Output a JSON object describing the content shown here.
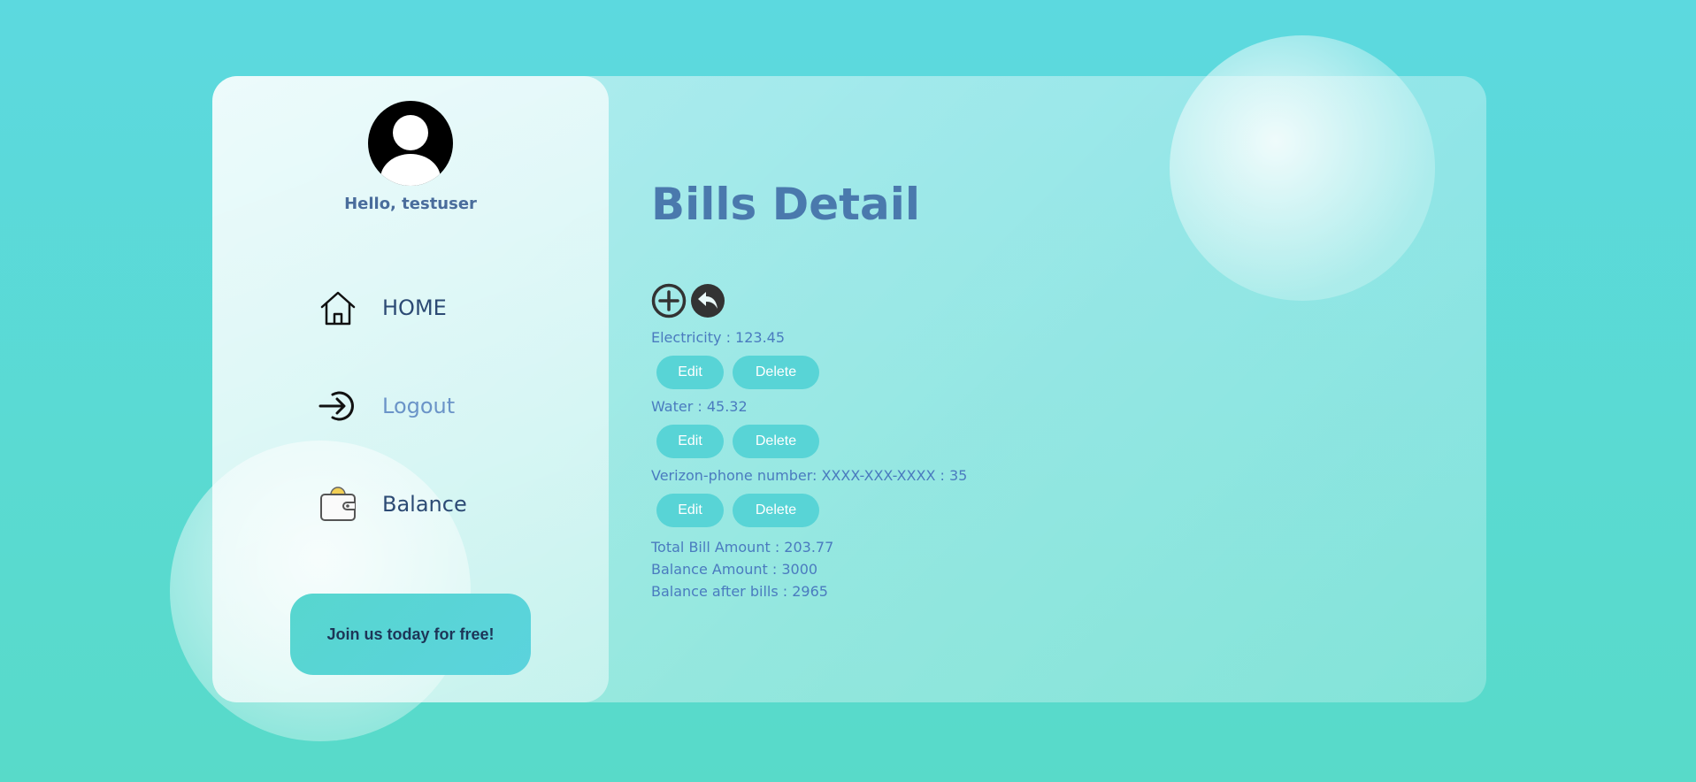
{
  "user": {
    "greeting": "Hello, testuser"
  },
  "sidebar": {
    "items": [
      {
        "label": "HOME",
        "icon": "home-icon"
      },
      {
        "label": "Logout",
        "icon": "logout-icon"
      },
      {
        "label": "Balance",
        "icon": "wallet-icon"
      }
    ],
    "cta_label": "Join us today for free!"
  },
  "main": {
    "title": "Bills Detail",
    "bills": [
      {
        "text": "Electricity : 123.45",
        "edit_label": "Edit",
        "delete_label": "Delete"
      },
      {
        "text": "Water : 45.32",
        "edit_label": "Edit",
        "delete_label": "Delete"
      },
      {
        "text": "Verizon-phone number: XXXX-XXX-XXXX : 35",
        "edit_label": "Edit",
        "delete_label": "Delete"
      }
    ],
    "summary": {
      "total": "Total Bill Amount : 203.77",
      "balance": "Balance Amount : 3000",
      "after": "Balance after bills : 2965"
    }
  },
  "colors": {
    "accent": "#58d4d6",
    "title": "#4a79ad",
    "text": "#4a7bbf"
  }
}
